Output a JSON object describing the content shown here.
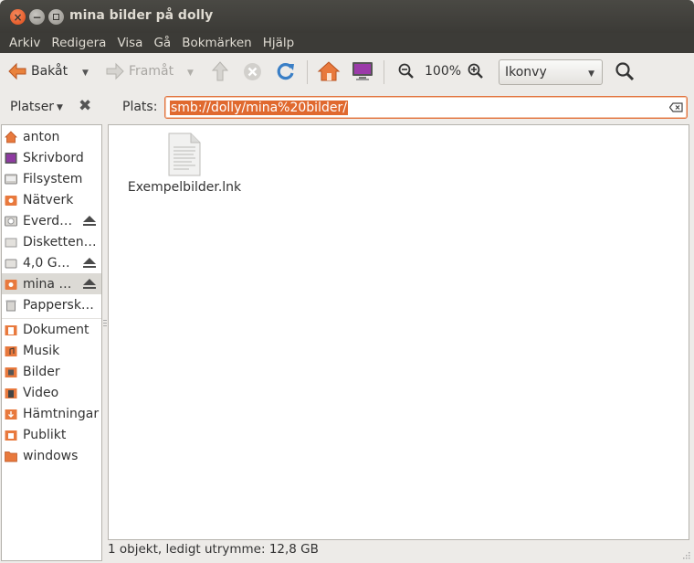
{
  "window": {
    "title": "mina bilder på dolly"
  },
  "menu": [
    "Arkiv",
    "Redigera",
    "Visa",
    "Gå",
    "Bokmärken",
    "Hjälp"
  ],
  "toolbar": {
    "back_label": "Bakåt",
    "forward_label": "Framåt",
    "zoom_level": "100%",
    "view_mode": "Ikonvy"
  },
  "location": {
    "places_label": "Platser",
    "location_label": "Plats:",
    "path": "smb://dolly/mina%20bilder/"
  },
  "sidebar": {
    "items": [
      {
        "label": "anton",
        "icon": "home-folder-icon"
      },
      {
        "label": "Skrivbord",
        "icon": "desktop-icon"
      },
      {
        "label": "Filsystem",
        "icon": "harddisk-icon"
      },
      {
        "label": "Nätverk",
        "icon": "network-folder-icon"
      },
      {
        "label": "Everd…",
        "icon": "optical-drive-icon",
        "eject": true
      },
      {
        "label": "Disketten…",
        "icon": "floppy-icon"
      },
      {
        "label": "4,0 G…",
        "icon": "removable-drive-icon",
        "eject": true
      },
      {
        "label": "mina …",
        "icon": "network-share-icon",
        "eject": true,
        "selected": true
      },
      {
        "label": "Pappersk…",
        "icon": "trash-icon"
      },
      {
        "label": "Dokument",
        "icon": "documents-folder-icon"
      },
      {
        "label": "Musik",
        "icon": "music-folder-icon"
      },
      {
        "label": "Bilder",
        "icon": "pictures-folder-icon"
      },
      {
        "label": "Video",
        "icon": "video-folder-icon"
      },
      {
        "label": "Hämtningar",
        "icon": "downloads-folder-icon"
      },
      {
        "label": "Publikt",
        "icon": "public-folder-icon"
      },
      {
        "label": "windows",
        "icon": "folder-icon"
      }
    ]
  },
  "files": [
    {
      "name": "Exempelbilder.lnk",
      "icon": "text-file-icon"
    }
  ],
  "status": {
    "text": "1 objekt, ledigt utrymme: 12,8 GB"
  },
  "colors": {
    "accent": "#e0692f",
    "titlebar": "#3c3b37",
    "folder": "#e8793d"
  }
}
